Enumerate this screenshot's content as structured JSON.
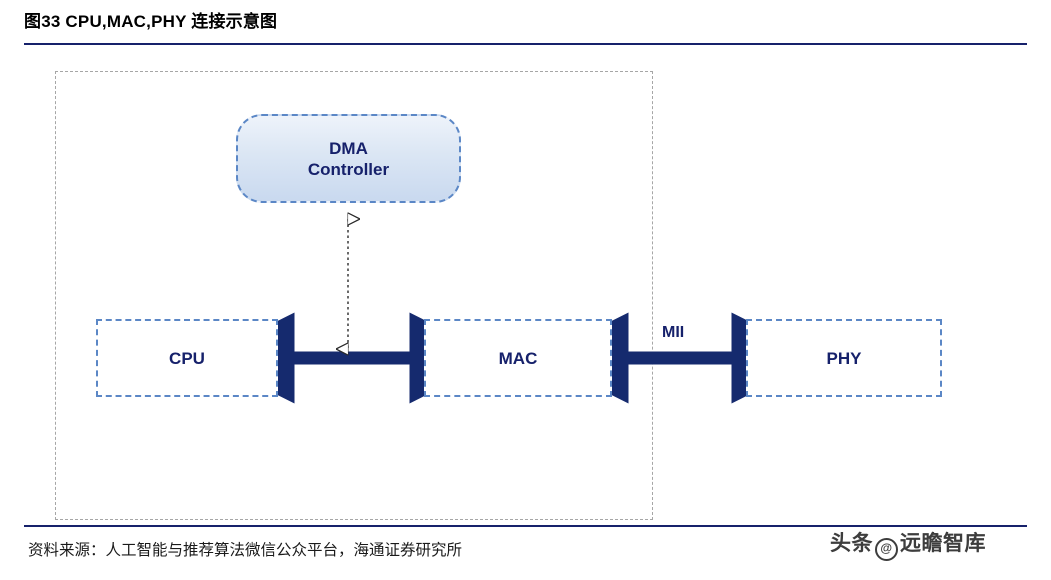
{
  "figure": {
    "title": "图33 CPU,MAC,PHY 连接示意图"
  },
  "diagram": {
    "nodes": [
      {
        "id": "dma",
        "label_line1": "DMA",
        "label_line2": "Controller"
      },
      {
        "id": "cpu",
        "label": "CPU"
      },
      {
        "id": "mac",
        "label": "MAC"
      },
      {
        "id": "phy",
        "label": "PHY"
      }
    ],
    "edges": [
      {
        "id": "cpu-mac",
        "style": "solid-double-arrow",
        "label": ""
      },
      {
        "id": "mac-phy",
        "style": "solid-double-arrow",
        "label": "MII"
      },
      {
        "id": "dma-bus",
        "style": "dotted-double-arrow",
        "label": ""
      }
    ],
    "edge_labels": {
      "mii": "MII"
    },
    "colors": {
      "accent_dark_blue": "#16216b",
      "node_border_blue": "#5b87c6",
      "arrow_blue": "#152a6e",
      "frame_gray": "#a6a6a6"
    }
  },
  "footer": {
    "source": "资料来源：人工智能与推荐算法微信公众平台，海通证券研究所",
    "watermark_prefix": "头条",
    "watermark_at": "@",
    "watermark_suffix": "远瞻智库"
  }
}
